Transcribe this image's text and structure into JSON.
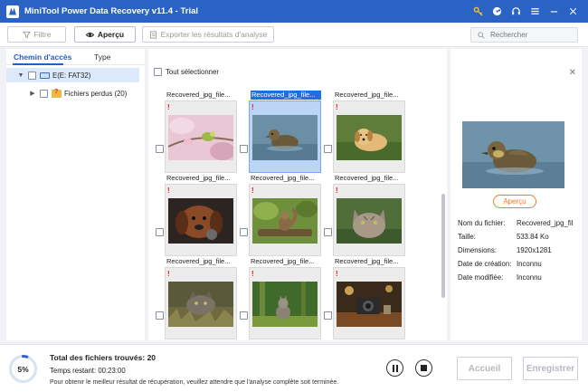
{
  "window": {
    "title": "MiniTool Power Data Recovery v11.4 - Trial"
  },
  "titlebar_icons": [
    "key-icon",
    "disc-icon",
    "headset-icon",
    "menu-icon",
    "minimize-icon",
    "close-icon"
  ],
  "toolbar": {
    "filter_label": "Filtre",
    "preview_label": "Aperçu",
    "export_label": "Exporter les résultats d'analyse",
    "search_placeholder": "Rechercher"
  },
  "left_tabs": [
    {
      "label": "Chemin d'accès",
      "active": true
    },
    {
      "label": "Type",
      "active": false
    }
  ],
  "tree": [
    {
      "label": "E(E: FAT32)",
      "icon": "drive-icon",
      "expanded": true,
      "selected": true
    },
    {
      "label": "Fichiers perdus (20)",
      "icon": "lost-folder-icon",
      "expanded": false,
      "selected": false
    }
  ],
  "center": {
    "select_all_label": "Tout sélectionner",
    "files": [
      {
        "name": "Recovered_jpg_file...",
        "selected": false,
        "image": "bird-on-branch"
      },
      {
        "name": "Recovered_jpg_file...",
        "selected": true,
        "image": "duckling"
      },
      {
        "name": "Recovered_jpg_file...",
        "selected": false,
        "image": "puppy"
      },
      {
        "name": "Recovered_jpg_file...",
        "selected": false,
        "image": "dog-with-ball"
      },
      {
        "name": "Recovered_jpg_file...",
        "selected": false,
        "image": "squirrel-on-log"
      },
      {
        "name": "Recovered_jpg_file...",
        "selected": false,
        "image": "tabby-cat"
      },
      {
        "name": "Recovered_jpg_file...",
        "selected": false,
        "image": "cat-in-grass"
      },
      {
        "name": "Recovered_jpg_file...",
        "selected": false,
        "image": "kitten-in-forest"
      },
      {
        "name": "Recovered_jpg_file...",
        "selected": false,
        "image": "camera-on-table"
      }
    ]
  },
  "preview": {
    "button_label": "Aperçu",
    "info": [
      {
        "key": "Nom du fichier:",
        "value": "Recovered_jpg_fil"
      },
      {
        "key": "Taille:",
        "value": "533.84 Ko"
      },
      {
        "key": "Dimensions:",
        "value": "1920x1281"
      },
      {
        "key": "Date de création:",
        "value": "Inconnu"
      },
      {
        "key": "Date modifiée:",
        "value": "Inconnu"
      }
    ]
  },
  "status": {
    "progress_percent": 5,
    "progress_label": "5%",
    "total_label": "Total des fichiers trouvés:",
    "total_value": "20",
    "time_label": "Temps restant:",
    "time_value": "00:23:00",
    "hint": "Pour obtenir le meilleur résultat de récupération, veuillez attendre que l'analyse complète soit terminée."
  },
  "bottom_buttons": {
    "home_label": "Accueil",
    "save_label": "Enregistrer"
  },
  "colors": {
    "accent": "#2a63c4",
    "selection": "#1f6fe0",
    "preview_button": "#f07a2a",
    "warning_mark": "#e02020"
  }
}
